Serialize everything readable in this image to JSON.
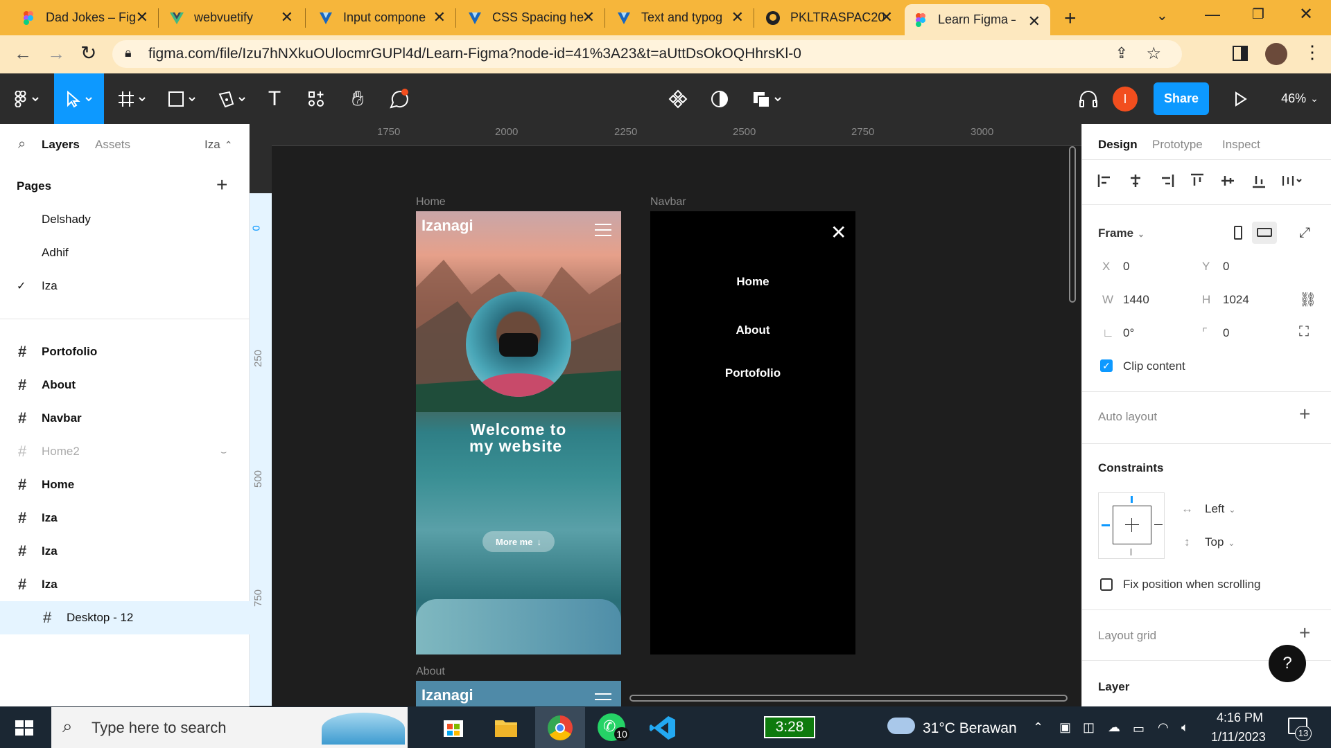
{
  "browser": {
    "tabs": [
      {
        "title": "Dad Jokes – Fig",
        "icon": "figma-icon"
      },
      {
        "title": "webvuetify",
        "icon": "vue-icon"
      },
      {
        "title": "Input compone",
        "icon": "vuetify-icon"
      },
      {
        "title": "CSS Spacing he",
        "icon": "vuetify-icon"
      },
      {
        "title": "Text and typog",
        "icon": "vuetify-icon"
      },
      {
        "title": "PKLTRASPAC20",
        "icon": "github-icon"
      },
      {
        "title": "Learn Figma – F",
        "icon": "figma-icon"
      }
    ],
    "url": "figma.com/file/Izu7hNXkuOUlocmrGUPl4d/Learn-Figma?node-id=41%3A23&t=aUttDsOkOQHhrsKl-0"
  },
  "toolbar": {
    "avatar_letter": "I",
    "share_label": "Share",
    "zoom": "46%"
  },
  "left_panel": {
    "tab_layers": "Layers",
    "tab_assets": "Assets",
    "page_switcher": "Iza",
    "pages_heading": "Pages",
    "pages": [
      "Delshady",
      "Adhif",
      "Iza"
    ],
    "layers": [
      "Portofolio",
      "About",
      "Navbar",
      "Home2",
      "Home",
      "Iza",
      "Iza",
      "Iza"
    ],
    "selected_layer": "Desktop - 12"
  },
  "ruler": {
    "top": [
      "1750",
      "2000",
      "2250",
      "2500",
      "2750",
      "3000"
    ],
    "left": [
      "0",
      "250",
      "500",
      "750"
    ]
  },
  "canvas": {
    "home_label": "Home",
    "navbar_label": "Navbar",
    "about_label": "About",
    "brand": "Izanagi",
    "welcome_line1": "Welcome to",
    "welcome_line2": "my website",
    "more_me": "More me",
    "nav_items": [
      "Home",
      "About",
      "Portofolio"
    ]
  },
  "right_panel": {
    "tabs": [
      "Design",
      "Prototype",
      "Inspect"
    ],
    "frame_label": "Frame",
    "x_label": "X",
    "x_value": "0",
    "y_label": "Y",
    "y_value": "0",
    "w_label": "W",
    "w_value": "1440",
    "h_label": "H",
    "h_value": "1024",
    "rotation": "0°",
    "radius": "0",
    "clip_content": "Clip content",
    "auto_layout": "Auto layout",
    "constraints": "Constraints",
    "constraint_h": "Left",
    "constraint_v": "Top",
    "fix_position": "Fix position when scrolling",
    "layout_grid": "Layout grid",
    "layer": "Layer",
    "help": "?"
  },
  "taskbar": {
    "search_placeholder": "Type here to search",
    "whatsapp_badge": "10",
    "battery_time": "3:28",
    "weather": "31°C  Berawan",
    "time": "4:16 PM",
    "date": "1/11/2023",
    "notif_count": "13"
  },
  "colors": {
    "tab_bar": "#f6b63b",
    "figma_toolbar": "#2c2c2c",
    "canvas": "#1e1e1e",
    "accent": "#0d99ff",
    "selection": "#e5f4ff",
    "avatar": "#f24e1e",
    "taskbar": "#1b2733"
  }
}
